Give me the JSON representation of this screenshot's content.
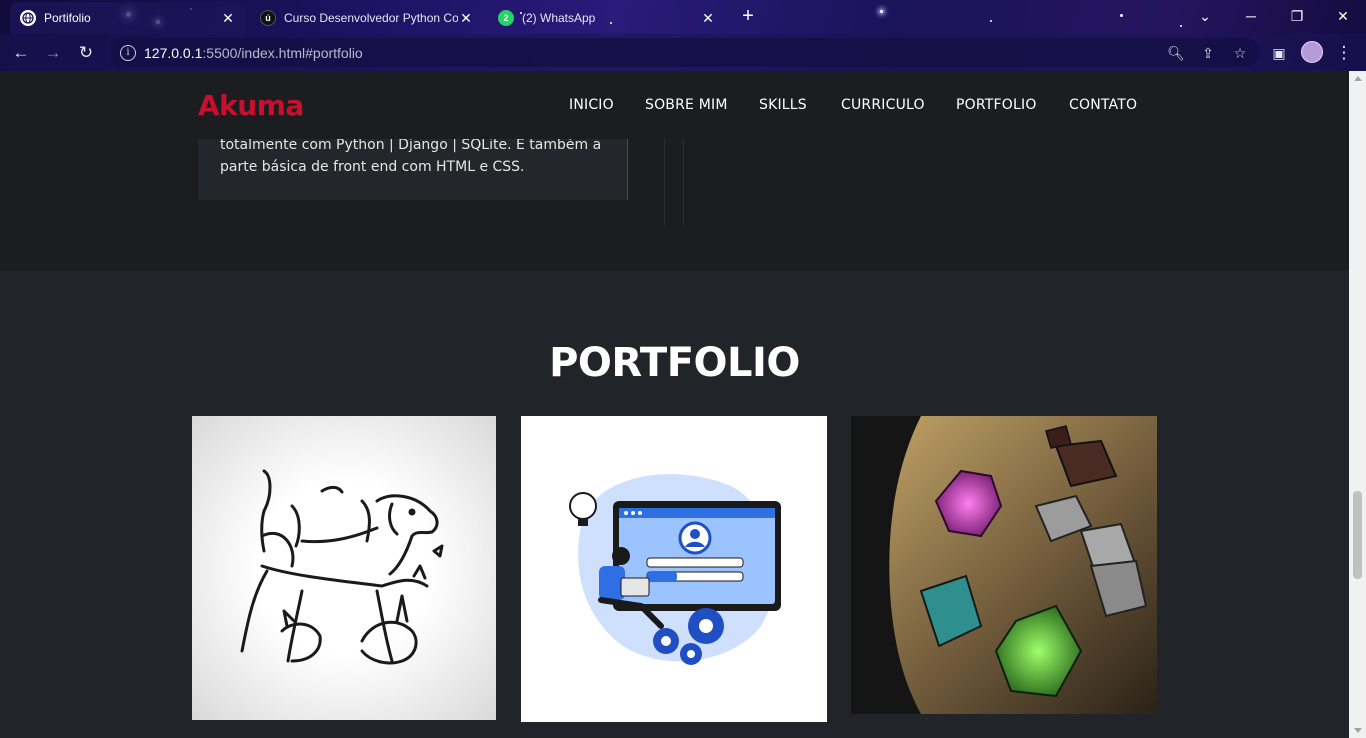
{
  "browser": {
    "tabs": [
      {
        "title": "Portifolio",
        "active": true,
        "favicon": "globe-icon"
      },
      {
        "title": "Curso Desenvolvedor Python Co",
        "active": false,
        "favicon": "udemy-icon"
      },
      {
        "title": "(2) WhatsApp",
        "active": false,
        "favicon": "whatsapp-icon",
        "badge": "2"
      }
    ],
    "address": {
      "host": "127.0.0.1",
      "rest": ":5500/index.html#portfolio"
    },
    "accent": "#1c1260"
  },
  "site": {
    "logo": "Akuma",
    "nav": [
      "INICIO",
      "SOBRE MIM",
      "SKILLS",
      "CURRICULO",
      "PORTFOLIO",
      "CONTATO"
    ],
    "card_text": "totalmente com Python | Django | SQLite. E também a parte básica de front end com HTML e CSS.",
    "portfolio_title": "PORTFOLIO",
    "colors": {
      "brand": "#c8102e",
      "bg": "#212529",
      "header_bg": "#1b1d20"
    }
  },
  "portfolio_items": [
    {
      "image": "pets-line-art-image"
    },
    {
      "image": "login-illustration-image"
    },
    {
      "image": "rpg-dice-image"
    }
  ]
}
